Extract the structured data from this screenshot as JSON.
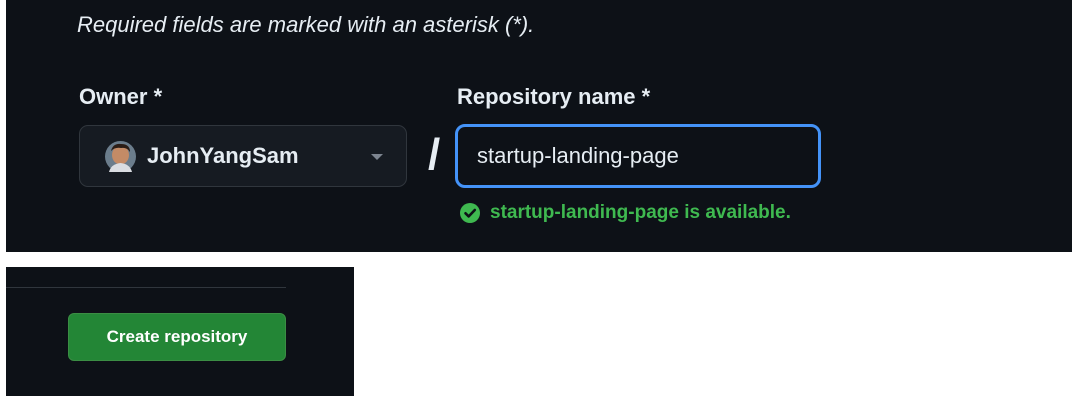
{
  "form": {
    "required_note": "Required fields are marked with an asterisk (*).",
    "owner": {
      "label": "Owner *",
      "selected": "JohnYangSam",
      "avatar_icon": "user-avatar",
      "caret_icon": "caret-down-icon"
    },
    "separator": "/",
    "repository": {
      "label": "Repository name *",
      "value": "startup-landing-page"
    },
    "availability": {
      "icon": "check-circle-fill-icon",
      "message": "startup-landing-page is available.",
      "color": "#3fb950"
    }
  },
  "actions": {
    "create_label": "Create repository"
  },
  "colors": {
    "background": "#0d1117",
    "text": "#e6edf3",
    "focus_border": "#4493f8",
    "primary_button": "#238636"
  }
}
